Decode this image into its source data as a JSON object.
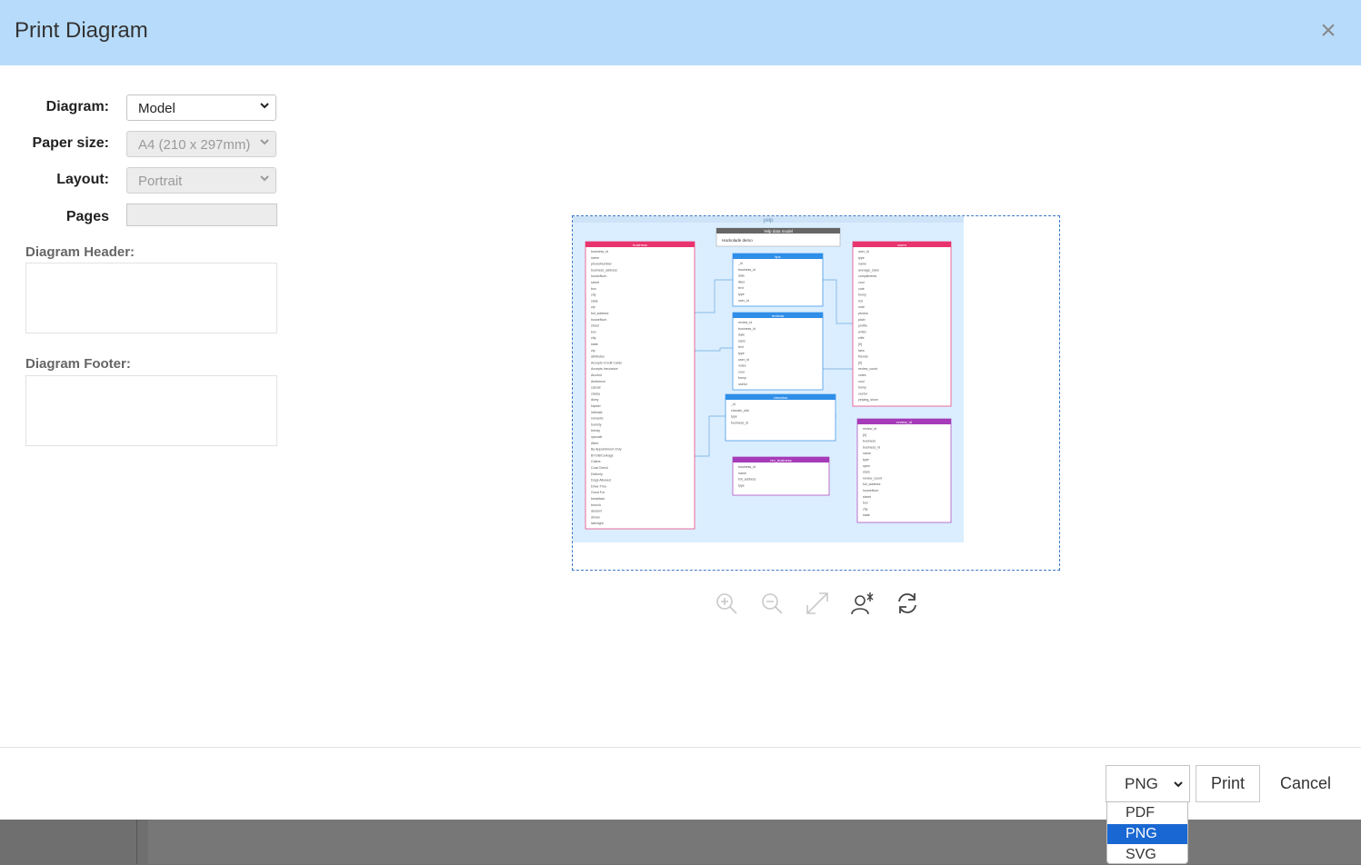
{
  "dialog": {
    "title": "Print Diagram",
    "close_label": "×"
  },
  "form": {
    "diagram_label": "Diagram:",
    "diagram_value": "Model",
    "paper_label": "Paper size:",
    "paper_value": "A4 (210 x 297mm)",
    "layout_label": "Layout:",
    "layout_value": "Portrait",
    "pages_label": "Pages",
    "header_label": "Diagram Header:",
    "footer_label": "Diagram Footer:"
  },
  "preview": {
    "project_name": "yelp",
    "note_title": "Yelp data model",
    "note_text": "Hackolade demo",
    "tables": [
      {
        "name": "business",
        "color": "#e8336d",
        "fields": [
          "business_id",
          "name",
          "phoneNumber",
          "business_address",
          "houseNum",
          "street",
          "box",
          "city",
          "state",
          "zip",
          "full_address",
          "houseNum",
          "street",
          "box",
          "city",
          "state",
          "zip",
          "attributes",
          "Accepts Credit Cards",
          "Accepts Insurance",
          "Alcohol",
          "Ambience",
          "casual",
          "classy",
          "divey",
          "hipster",
          "intimate",
          "romantic",
          "touristy",
          "trendy",
          "upscale",
          "Attire",
          "By Appointment Only",
          "BYOB/Corkage",
          "Caters",
          "Coat Check",
          "Delivery",
          "Dogs Allowed",
          "Drive-Thru",
          "Good For",
          "breakfast",
          "brunch",
          "dessert",
          "dinner",
          "latenight"
        ]
      },
      {
        "name": "tips",
        "color": "#2e8ee8",
        "fields": [
          "_id",
          "business_id",
          "date",
          "likes",
          "text",
          "type",
          "user_id"
        ]
      },
      {
        "name": "reviews",
        "color": "#2e8ee8",
        "fields": [
          "review_id",
          "business_id",
          "date",
          "stars",
          "text",
          "type",
          "user_id",
          "votes",
          "cool",
          "funny",
          "useful"
        ]
      },
      {
        "name": "checkins",
        "color": "#2e8ee8",
        "fields": [
          "_id",
          "checkin_info",
          "type",
          "business_id"
        ]
      },
      {
        "name": "rev_business",
        "color": "#a53bb8",
        "fields": [
          "business_id",
          "name",
          "full_address",
          "type"
        ]
      },
      {
        "name": "users",
        "color": "#e8336d",
        "fields": [
          "user_id",
          "type",
          "name",
          "average_stars",
          "compliments",
          "cool",
          "cute",
          "funny",
          "hot",
          "note",
          "photos",
          "plain",
          "profile",
          "writer",
          "elite",
          "[0]",
          "fans",
          "friends",
          "[0]",
          "review_count",
          "votes",
          "cool",
          "funny",
          "useful",
          "yelping_since"
        ]
      },
      {
        "name": "review_id",
        "color": "#a53bb8",
        "fields": [
          "review_id",
          "[0]",
          "business",
          "business_id",
          "name",
          "type",
          "open",
          "stars",
          "review_count",
          "full_address",
          "houseNum",
          "street",
          "box",
          "city",
          "state"
        ]
      }
    ]
  },
  "toolbar": {
    "zoom_in": "zoom-in",
    "zoom_out": "zoom-out",
    "fit": "fit-to-page",
    "reset": "reset-view",
    "refresh": "refresh"
  },
  "footer": {
    "format_value": "PNG",
    "print_label": "Print",
    "cancel_label": "Cancel",
    "format_options": [
      "PDF",
      "PNG",
      "SVG"
    ],
    "selected_option": "PNG"
  },
  "colors": {
    "header_bg": "#b7dcfb",
    "selected_option_bg": "#1967d2",
    "preview_border": "#3d78c9"
  }
}
